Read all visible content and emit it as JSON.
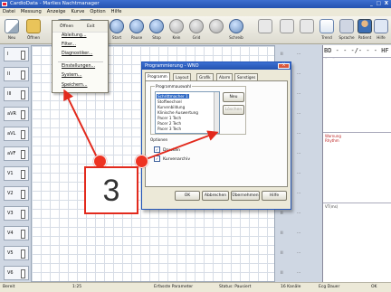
{
  "window": {
    "title": "CardioData - Marlies Nachtmanager",
    "controls": "_ □ X"
  },
  "menubar": [
    "Datei",
    "Messung",
    "Anzeige",
    "Kurve",
    "Option",
    "Hilfe"
  ],
  "toolbar": [
    {
      "label": "Neu",
      "icon": "doc-icon"
    },
    {
      "label": "Öffnen",
      "icon": "folder-icon"
    },
    {
      "label": "",
      "icon": "doc-icon"
    },
    {
      "label": "",
      "icon": "doc-icon"
    },
    {
      "label": "Start",
      "icon": "round-icon"
    },
    {
      "label": "Pause",
      "icon": "round-icon"
    },
    {
      "label": "Stop",
      "icon": "round-icon"
    },
    {
      "label": "Kein",
      "icon": "grey-icon"
    },
    {
      "label": "Grid",
      "icon": "grey-icon"
    },
    {
      "label": "",
      "icon": "grey-icon"
    },
    {
      "label": "Schreib",
      "icon": "round-icon"
    },
    {
      "label": "",
      "icon": "pin-icon"
    },
    {
      "label": "",
      "icon": "pin-icon"
    },
    {
      "label": "",
      "icon": "pin-icon"
    },
    {
      "label": "Trend",
      "icon": "chart-icon"
    },
    {
      "label": "Sprache",
      "icon": "shield-icon"
    },
    {
      "label": "Patient",
      "icon": "person-icon"
    },
    {
      "label": "Hilfe",
      "icon": "help-icon"
    }
  ],
  "dropdown": {
    "header": [
      "Öffnen",
      "Exit"
    ],
    "items": [
      "Ableitung...",
      "Filter...",
      "Diagnostiker...",
      "Einstellungen...",
      "System...",
      "Speichern..."
    ]
  },
  "channels": [
    "I",
    "II",
    "III",
    "aVR",
    "aVL",
    "aVF",
    "V1",
    "V2",
    "V3",
    "V4",
    "V5",
    "V6"
  ],
  "midstrip": {
    "a": "II",
    "b": "···"
  },
  "rightpanel": {
    "header": "BD - - -/- - -   HF - -",
    "labels": [
      "Warnung",
      "Rhythm",
      "VT(ms)"
    ]
  },
  "dialog": {
    "title": "Programmierung - WNO",
    "close": "X",
    "tabs": [
      "Programm",
      "Layout",
      "Grafik",
      "Alarm",
      "Sonstiges"
    ],
    "group_label": "Programmauswahl",
    "list": [
      "Schrittmacher 1",
      "Stoffwechsel",
      "Kurvenbildung",
      "Klinische Auswertung",
      "Pacer 1 Tech",
      "Pacer 2 Tech",
      "Pacer 3 Tech"
    ],
    "list_selected": 0,
    "btn_new": "Neu",
    "btn_delete": "Löschen",
    "opt_group_label": "Optionen",
    "options": [
      "Drucken",
      "Kurvenarchiv"
    ],
    "buttons": [
      "OK",
      "Abbrechen",
      "Übernehmen",
      "Hilfe"
    ]
  },
  "callout": {
    "number": "3"
  },
  "status": [
    "Bereit",
    "1:25",
    "Erfasste Parameter",
    "Status: Pausiert",
    "16 Kanäle",
    "Ecg Dauer",
    "OK"
  ]
}
